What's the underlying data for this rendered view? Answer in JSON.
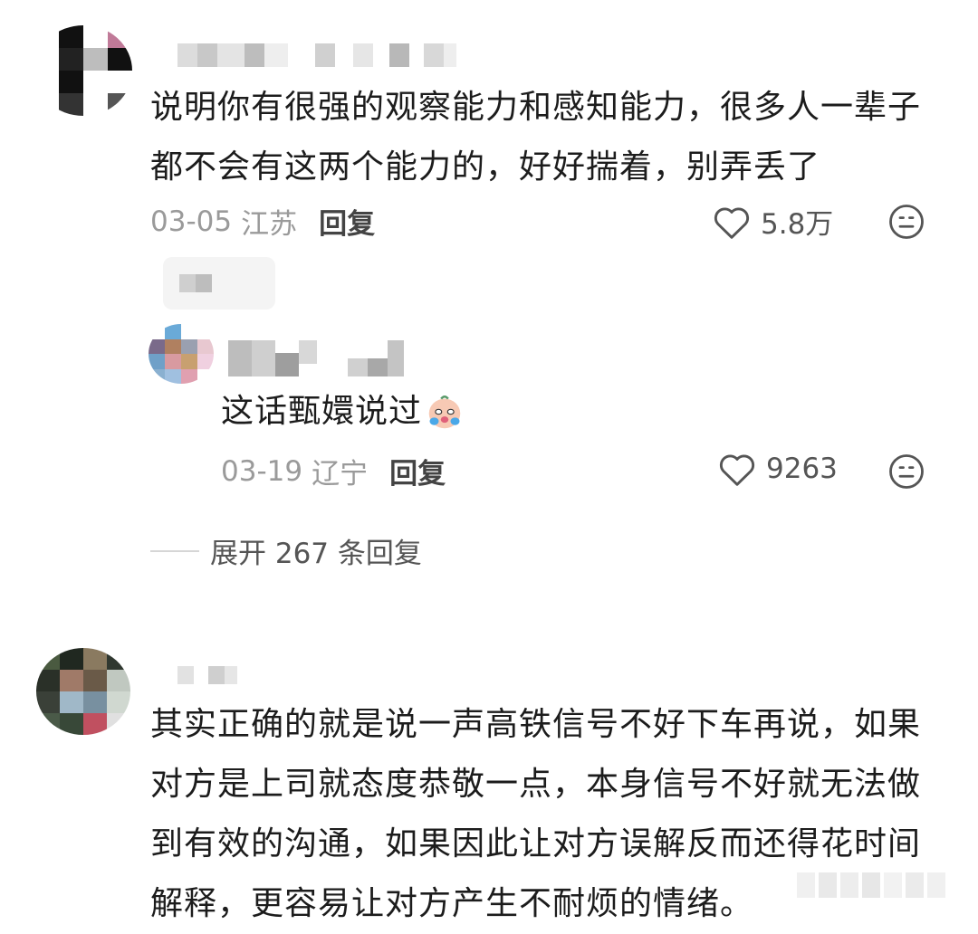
{
  "comments": [
    {
      "text_line1": "说明你有很强的观察能力和感知能力，很多人一辈子",
      "text_line2": "都不会有这两个能力的，好好揣着，别弄丢了",
      "date": "03-05",
      "location": "江苏",
      "reply_label": "回复",
      "likes": "5.8万",
      "replies": [
        {
          "text": "这话甄嬛说过",
          "emoji": "crying-face",
          "date": "03-19",
          "location": "辽宁",
          "reply_label": "回复",
          "likes": "9263"
        }
      ],
      "expand_label": "展开 267 条回复"
    },
    {
      "text_line1": "其实正确的就是说一声高铁信号不好下车再说，如果",
      "text_line2": "对方是上司就态度恭敬一点，本身信号不好就无法做",
      "text_line3": "到有效的沟通，如果因此让对方误解反而还得花时间",
      "text_line4": "解释，更容易让对方产生不耐烦的情绪。"
    }
  ],
  "icons": {
    "like": "heart-outline-icon",
    "react": "neutral-face-icon"
  },
  "colors": {
    "meta_gray": "#9a9a9a",
    "text": "#1c1c1c"
  }
}
